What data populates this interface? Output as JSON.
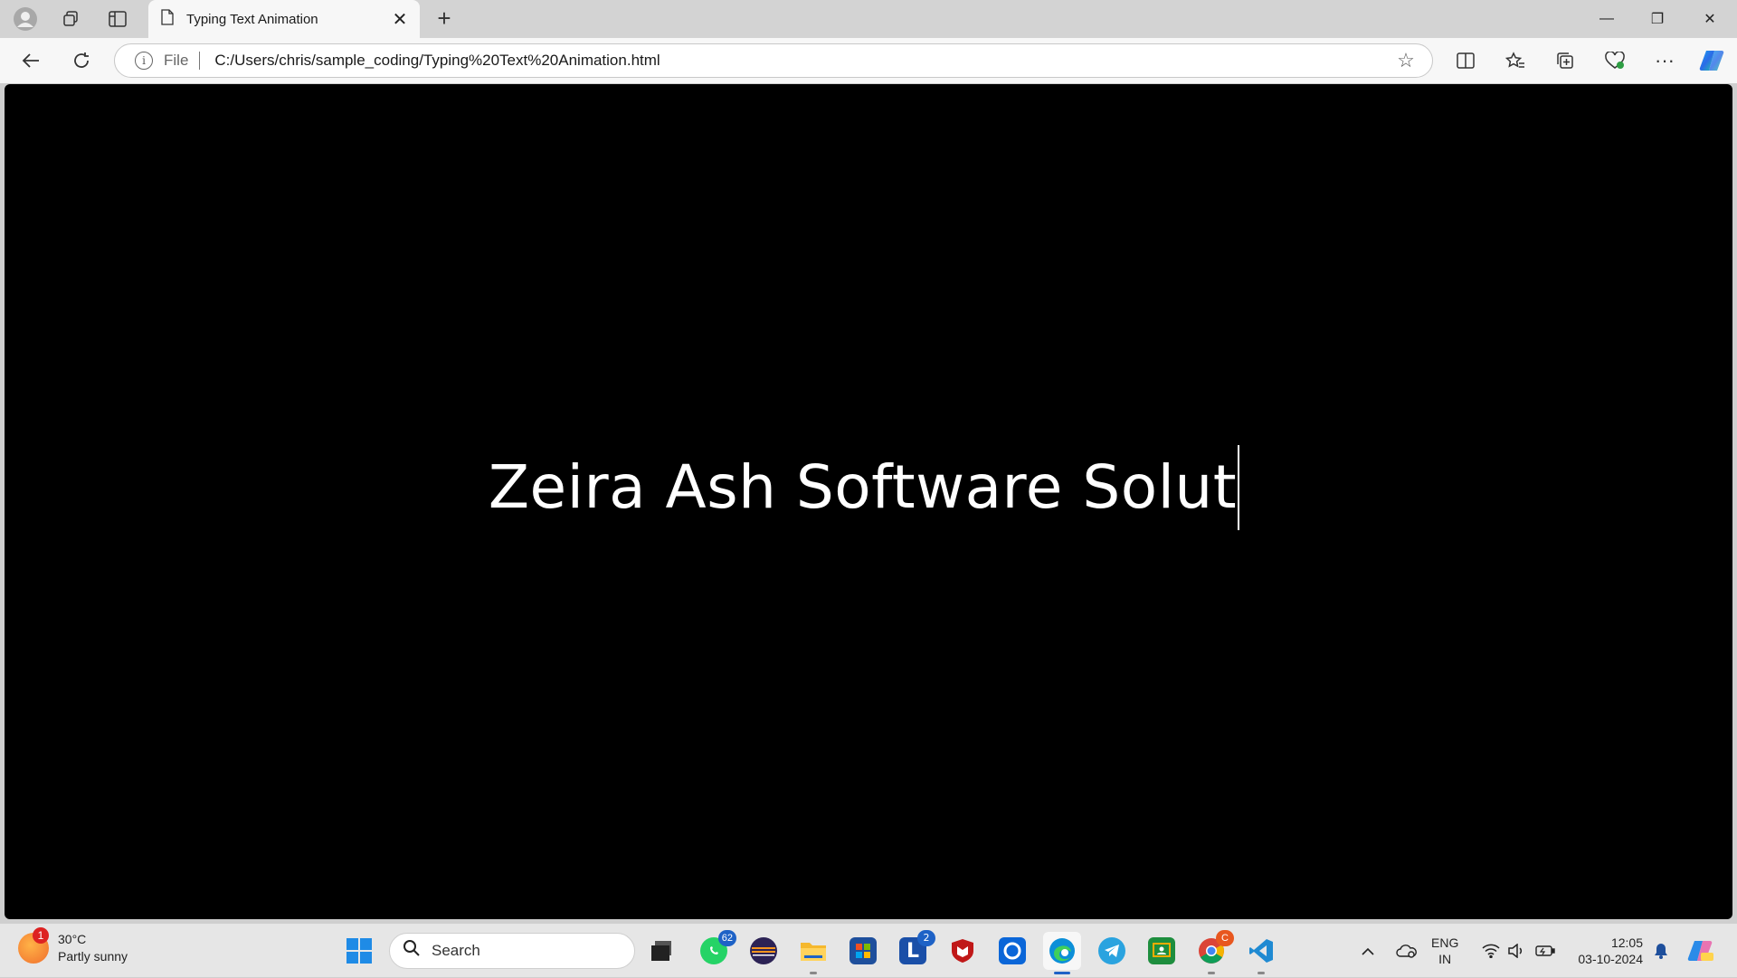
{
  "browser": {
    "tab_title": "Typing Text Animation",
    "tab_close": "✕",
    "new_tab": "+",
    "file_label": "File",
    "url": "C:/Users/chris/sample_coding/Typing%20Text%20Animation.html",
    "window_controls": {
      "minimize": "—",
      "restore": "❐",
      "close": "✕"
    }
  },
  "page": {
    "typed_text": "Zeira Ash Software Solut",
    "background_color": "#000000",
    "text_color": "#ffffff"
  },
  "taskbar": {
    "weather": {
      "badge": "1",
      "temperature": "30°C",
      "condition": "Partly sunny"
    },
    "search_placeholder": "Search",
    "apps": [
      {
        "name": "task-view",
        "badge": ""
      },
      {
        "name": "whatsapp",
        "badge": "62"
      },
      {
        "name": "eclipse",
        "badge": ""
      },
      {
        "name": "file-explorer",
        "badge": ""
      },
      {
        "name": "microsoft-store",
        "badge": ""
      },
      {
        "name": "l-app",
        "badge": "2",
        "label": "L"
      },
      {
        "name": "mcafee",
        "badge": ""
      },
      {
        "name": "cortana",
        "badge": ""
      },
      {
        "name": "edge",
        "badge": ""
      },
      {
        "name": "telegram",
        "badge": ""
      },
      {
        "name": "google-classroom",
        "badge": ""
      },
      {
        "name": "chrome",
        "badge": "C"
      },
      {
        "name": "vscode",
        "badge": ""
      }
    ],
    "language": {
      "line1": "ENG",
      "line2": "IN"
    },
    "clock": {
      "time": "12:05",
      "date": "03-10-2024"
    }
  }
}
